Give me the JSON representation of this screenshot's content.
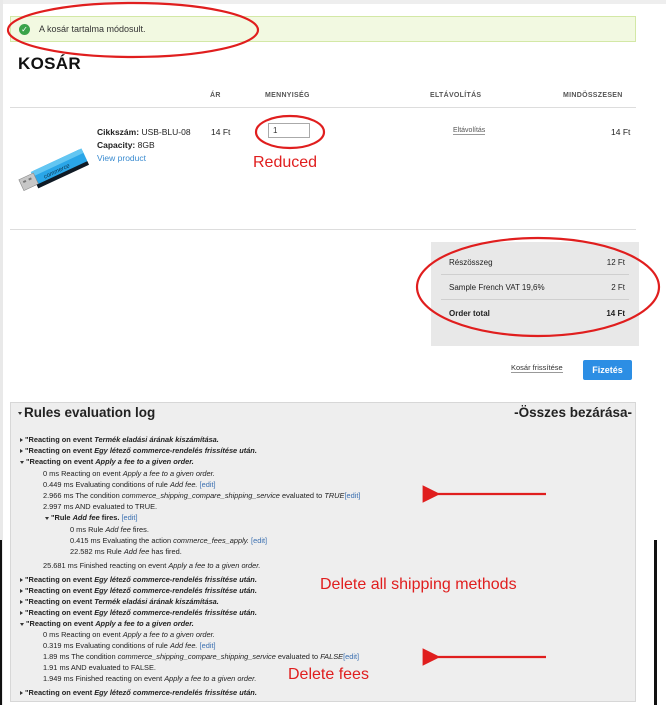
{
  "message": {
    "text": "A kosár tartalma módosult."
  },
  "page_title": "KOSÁR",
  "table_headers": {
    "price": "ÁR",
    "quantity": "MENNYISÉG",
    "remove": "ELTÁVOLÍTÁS",
    "total": "MINDÖSSZESEN"
  },
  "item": {
    "sku_label": "Cikkszám:",
    "sku": "USB-BLU-08",
    "capacity_label": "Capacity:",
    "capacity": "8GB",
    "view_link": "View product",
    "price": "14 Ft",
    "quantity": "1",
    "remove_label": "Eltávolítás",
    "total": "14 Ft",
    "image_icon": "usb-flash-drive-icon"
  },
  "annotations": {
    "reduced": "Reduced",
    "delete_shipping": "Delete all shipping methods",
    "delete_fees": "Delete fees",
    "color": "#e01e1e"
  },
  "totals": {
    "subtotal_label": "Részösszeg",
    "subtotal": "12 Ft",
    "vat_label": "Sample French VAT 19,6%",
    "vat": "2 Ft",
    "order_total_label": "Order total",
    "order_total": "14 Ft"
  },
  "buttons": {
    "update_cart": "Kosár frissítése",
    "checkout": "Fizetés",
    "checkout_color": "#2c8ee4"
  },
  "log": {
    "title": "Rules evaluation log",
    "collapse_all": "-Összes bezárása-",
    "edit": "[edit]",
    "lines": {
      "l1_pre": "\"Reacting on event ",
      "l1_em": "Termék eladási árának kiszámítása.",
      "l2_pre": "\"Reacting on event ",
      "l2_em": "Egy létező commerce-rendelés frissítése után.",
      "l3_pre": "\"Reacting on event ",
      "l3_em": "Apply a fee to a given order.",
      "l4_pre": "0 ms Reacting on event ",
      "l4_em": "Apply a fee to a given order.",
      "l5_pre": "0.449 ms Evaluating conditions of rule ",
      "l5_em": "Add fee.",
      "l6_pre": "2.966 ms The condition ",
      "l6_em": "commerce_shipping_compare_shipping_service",
      "l6_mid": " evaluated to ",
      "l6_em2": "TRUE",
      "l7": "2.997 ms AND evaluated to TRUE.",
      "l8_pre": "\"Rule ",
      "l8_em": "Add fee",
      "l8_post": " fires.",
      "l9_pre": "0 ms Rule ",
      "l9_em": "Add fee",
      "l9_post": " fires.",
      "l10_pre": "0.415 ms Evaluating the action ",
      "l10_em": "commerce_fees_apply.",
      "l11_pre": "22.582 ms Rule ",
      "l11_em": "Add fee",
      "l11_post": " has fired.",
      "l12_pre": "25.681 ms Finished reacting on event ",
      "l12_em": "Apply a fee to a given order.",
      "l13_pre": "\"Reacting on event ",
      "l13_em": "Egy létező commerce-rendelés frissítése után.",
      "l14_pre": "\"Reacting on event ",
      "l14_em": "Egy létező commerce-rendelés frissítése után.",
      "l15_pre": "\"Reacting on event ",
      "l15_em": "Termék eladási árának kiszámítása.",
      "l16_pre": "\"Reacting on event ",
      "l16_em": "Egy létező commerce-rendelés frissítése után.",
      "l17_pre": "\"Reacting on event ",
      "l17_em": "Apply a fee to a given order.",
      "l18_pre": "0 ms Reacting on event ",
      "l18_em": "Apply a fee to a given order.",
      "l19_pre": "0.319 ms Evaluating conditions of rule ",
      "l19_em": "Add fee.",
      "l20_pre": "1.89 ms The condition ",
      "l20_em": "commerce_shipping_compare_shipping_service",
      "l20_mid": " evaluated to ",
      "l20_em2": "FALSE",
      "l21": "1.91 ms AND evaluated to FALSE.",
      "l22_pre": "1.949 ms Finished reacting on event ",
      "l22_em": "Apply a fee to a given order.",
      "l23_pre": "\"Reacting on event ",
      "l23_em": "Egy létező commerce-rendelés frissítése után."
    }
  }
}
